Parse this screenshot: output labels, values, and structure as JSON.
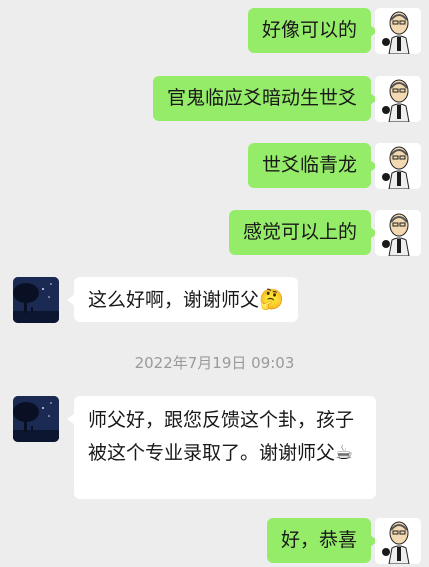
{
  "messages": [
    {
      "sender": "me",
      "text": "好像可以的"
    },
    {
      "sender": "me",
      "text": "官鬼临应爻暗动生世爻"
    },
    {
      "sender": "me",
      "text": "世爻临青龙"
    },
    {
      "sender": "me",
      "text": "感觉可以上的"
    },
    {
      "sender": "other",
      "text": "这么好啊，谢谢师父",
      "emoji": "🤔"
    },
    {
      "sender": "other",
      "text": "师父好，跟您反馈这个卦，孩子被这个专业录取了。谢谢师父",
      "emoji": "☕"
    },
    {
      "sender": "me",
      "text": "好，恭喜"
    }
  ],
  "timestamp": "2022年7月19日 09:03",
  "avatars": {
    "me": "cartoon-man-avatar",
    "other": "night-tree-avatar"
  },
  "colors": {
    "background": "#ededed",
    "my_bubble": "#95ec69",
    "other_bubble": "#ffffff",
    "timestamp_text": "#9a9a9a"
  }
}
